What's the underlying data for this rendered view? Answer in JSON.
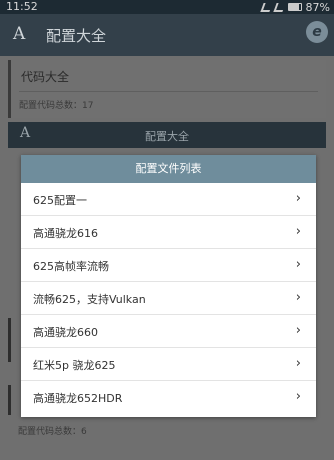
{
  "status_bar": {
    "time": "11:52",
    "battery": "87%"
  },
  "app_bar": {
    "title": "配置大全",
    "logo_glyph": "A",
    "browser_glyph": "e"
  },
  "background": {
    "card_title": "代码大全",
    "card_count": "配置代码总数：17",
    "section_title": "配置大全",
    "section_count": "配置代码总数：6"
  },
  "dialog": {
    "title": "配置文件列表",
    "items": [
      {
        "label": "625配置一"
      },
      {
        "label": "高通骁龙616"
      },
      {
        "label": "625高帧率流畅"
      },
      {
        "label": "流畅625，支持Vulkan"
      },
      {
        "label": "高通骁龙660"
      },
      {
        "label": "红米5p 骁龙625"
      },
      {
        "label": "高通骁龙652HDR"
      }
    ],
    "chevron": "›"
  },
  "colors": {
    "app_bar": "#33404a",
    "dialog_header": "#6f8d9c",
    "overlay": "#6f6f6f"
  }
}
